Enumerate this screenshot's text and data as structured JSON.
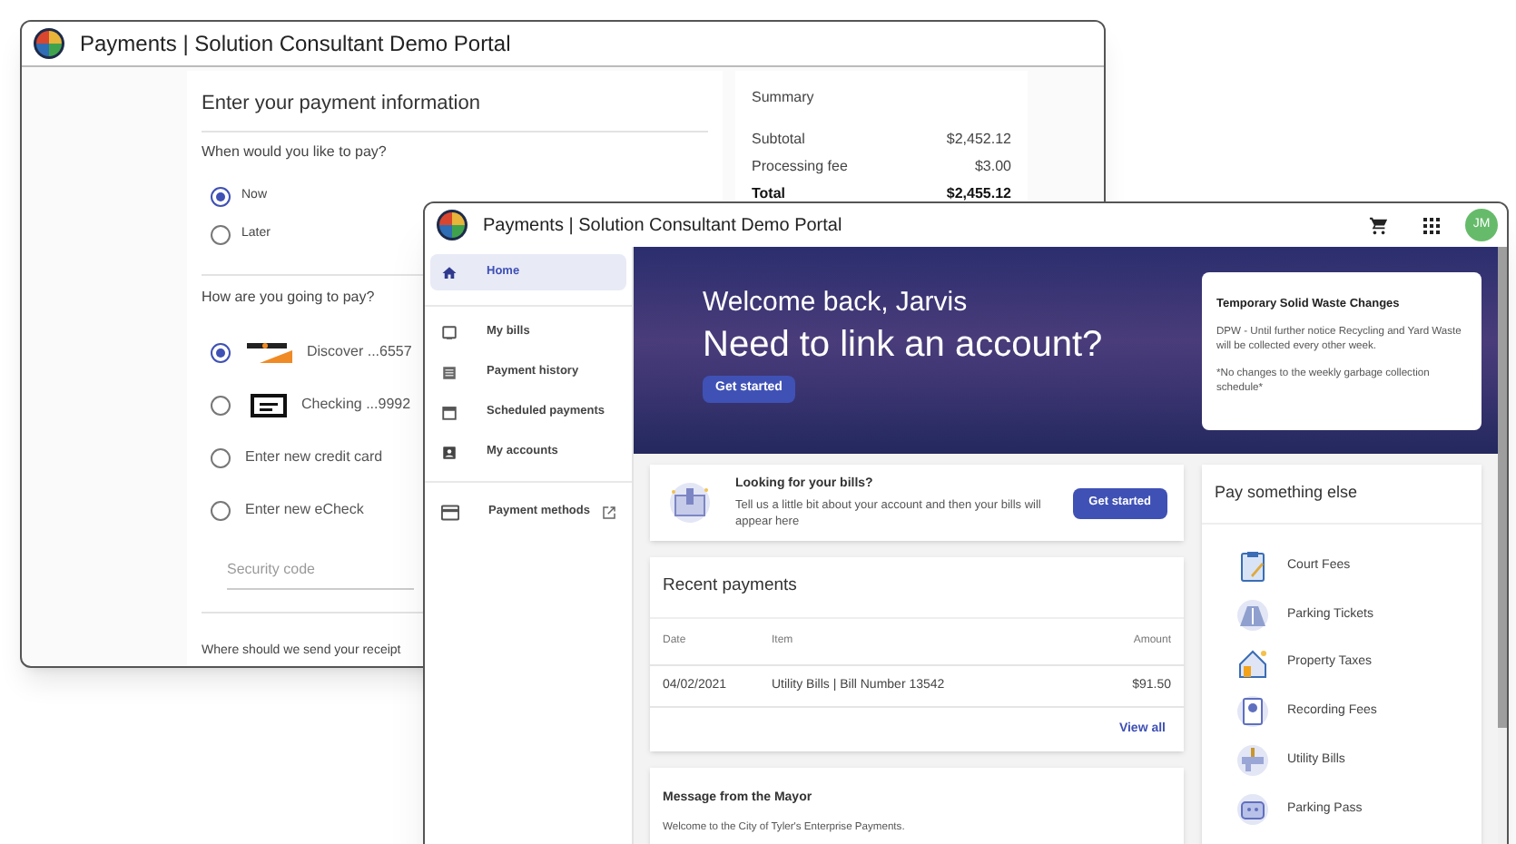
{
  "back_window": {
    "title": "Payments | Solution Consultant Demo Portal",
    "form": {
      "heading": "Enter your payment information",
      "when_label": "When would you like to pay?",
      "timing_options": [
        {
          "label": "Now",
          "selected": true
        },
        {
          "label": "Later",
          "selected": false
        }
      ],
      "method_label": "How are you going to pay?",
      "methods": [
        {
          "kind": "card",
          "label": "Discover ...6557",
          "selected": true
        },
        {
          "kind": "check",
          "label": "Checking ...9992",
          "selected": false
        },
        {
          "kind": "new",
          "label": "Enter new credit card",
          "selected": false
        },
        {
          "kind": "new",
          "label": "Enter new eCheck",
          "selected": false
        }
      ],
      "security_code": {
        "placeholder": "Security code"
      },
      "receipt_label": "Where should we send your receipt"
    },
    "summary": {
      "title": "Summary",
      "rows": [
        {
          "kind": "line",
          "label": "Subtotal",
          "value": "$2,452.12"
        },
        {
          "kind": "line",
          "label": "Processing fee",
          "value": "$3.00"
        },
        {
          "kind": "total",
          "label": "Total",
          "value": "$2,455.12"
        }
      ]
    }
  },
  "front_window": {
    "title": "Payments | Solution Consultant Demo Portal",
    "avatar": "JM",
    "sidebar": {
      "items": [
        {
          "label": "Home",
          "selected": true,
          "external": false
        },
        {
          "label": "My bills",
          "selected": false,
          "external": false
        },
        {
          "label": "Payment history",
          "selected": false,
          "external": false
        },
        {
          "label": "Scheduled payments",
          "selected": false,
          "external": false
        },
        {
          "label": "My accounts",
          "selected": false,
          "external": false
        },
        {
          "label": "Payment methods",
          "selected": false,
          "external": true
        }
      ]
    },
    "hero": {
      "greeting": "Welcome back, Jarvis",
      "headline": "Need to link an account?",
      "button": "Get started"
    },
    "notice": {
      "title": "Temporary Solid Waste Changes",
      "text": "DPW - Until further notice Recycling and Yard Waste will be collected every other week.",
      "note": "*No changes to the weekly garbage collection schedule*"
    },
    "bills_card": {
      "title": "Looking for your bills?",
      "text": "Tell us a little bit about your account and then your bills will appear here",
      "button": "Get started"
    },
    "recent_payments": {
      "title": "Recent payments",
      "columns": [
        "Date",
        "Item",
        "Amount"
      ],
      "rows": [
        {
          "date": "04/02/2021",
          "item": "Utility Bills | Bill Number 13542",
          "amount": "$91.50"
        }
      ],
      "link": "View all"
    },
    "mayor": {
      "title": "Message from the Mayor",
      "text": "Welcome to the City of Tyler's Enterprise Payments."
    },
    "pay_else": {
      "title": "Pay something else",
      "items": [
        "Court Fees",
        "Parking Tickets",
        "Property Taxes",
        "Recording Fees",
        "Utility Bills",
        "Parking Pass"
      ]
    }
  }
}
